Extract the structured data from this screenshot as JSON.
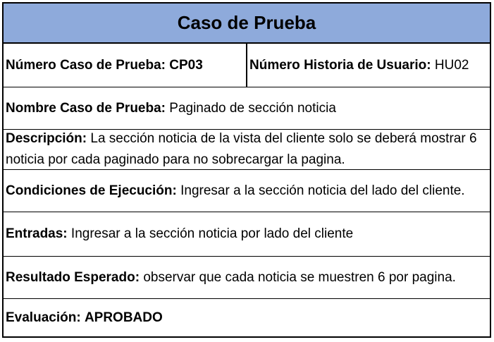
{
  "title": "Caso de Prueba",
  "numero_caso": {
    "label": "Número Caso de Prueba:",
    "value": "CP03"
  },
  "numero_historia": {
    "label": "Número Historia de Usuario:",
    "value": "HU02"
  },
  "nombre": {
    "label": "Nombre Caso de Prueba:",
    "value": "Paginado de sección noticia"
  },
  "descripcion": {
    "label": "Descripción:",
    "value": "La sección noticia de la vista del cliente solo se deberá mostrar 6 noticia por cada paginado para no sobrecargar la pagina."
  },
  "condiciones": {
    "label": "Condiciones de Ejecución:",
    "value": "Ingresar a la sección noticia del lado del cliente."
  },
  "entradas": {
    "label": "Entradas:",
    "value": "Ingresar a la sección noticia por lado del cliente"
  },
  "resultado": {
    "label": "Resultado Esperado:",
    "value": "observar que cada noticia se muestren 6 por pagina."
  },
  "evaluacion": {
    "label": "Evaluación:",
    "value": "APROBADO"
  },
  "colors": {
    "header_background": "#8eaadb",
    "border": "#000000"
  }
}
